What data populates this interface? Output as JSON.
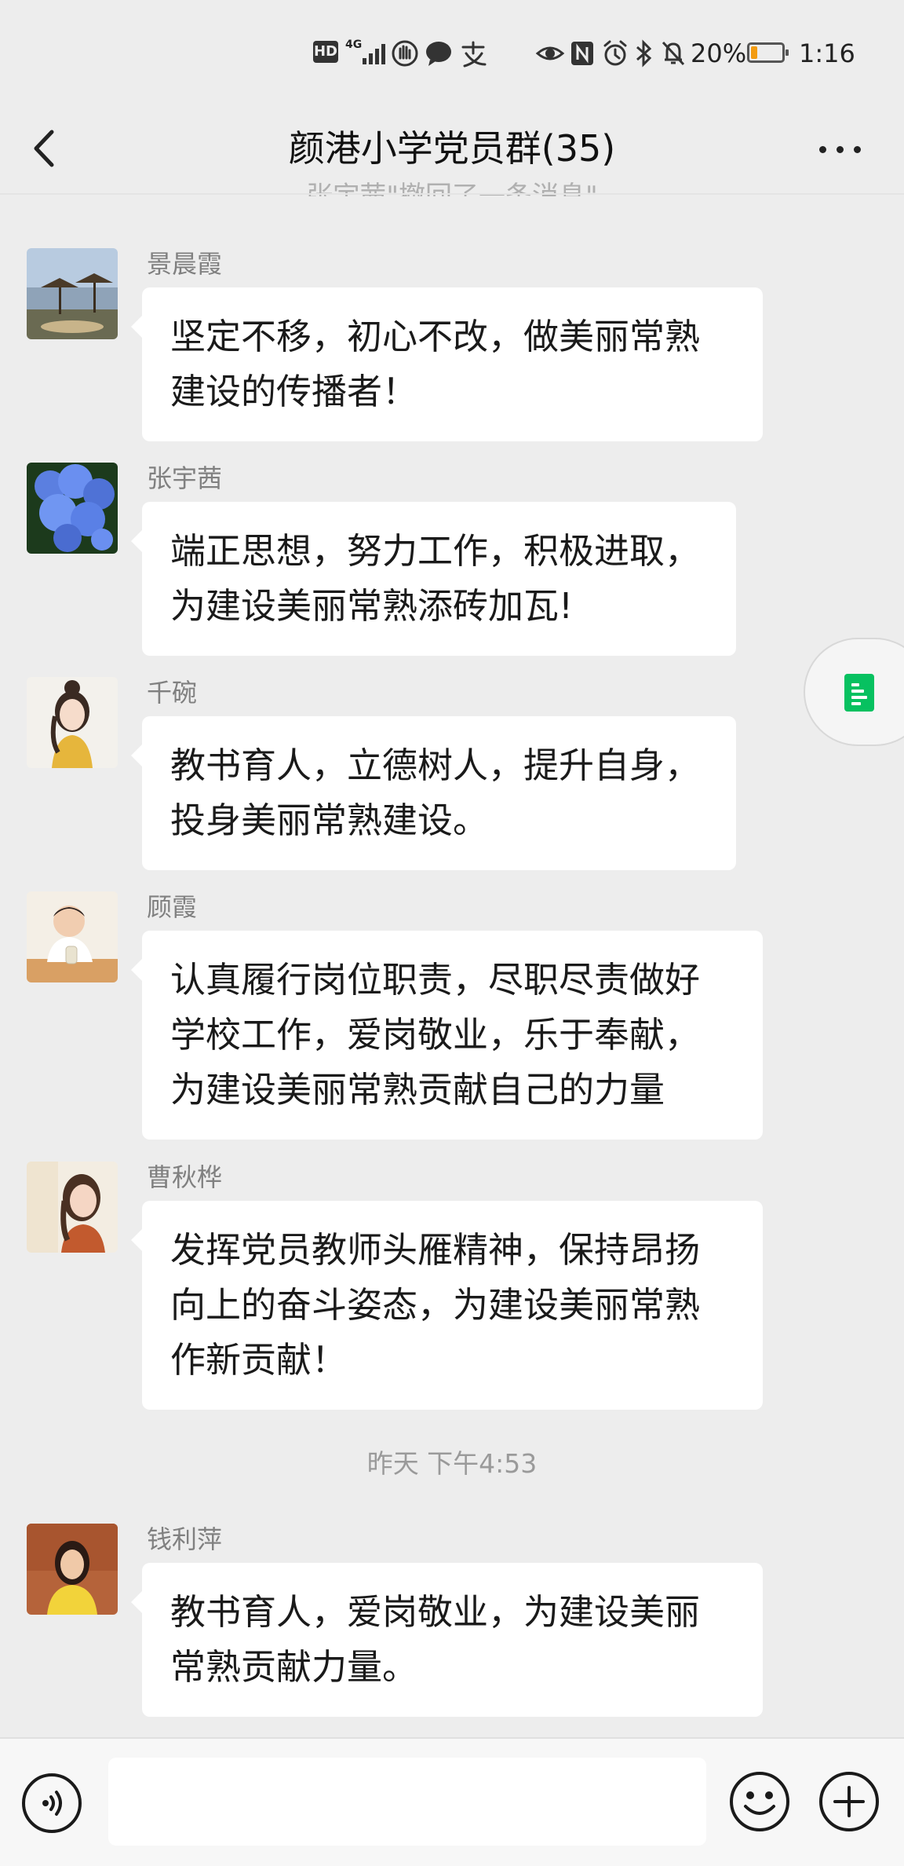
{
  "status_bar": {
    "hd": "HD",
    "network": "4G",
    "battery": "20%",
    "battery_level": 0.2,
    "time": "1:16",
    "icons": [
      "hd-icon",
      "signal-icon",
      "hand-icon",
      "chat-bubble-icon",
      "app-icon",
      "eye-icon",
      "nfc-icon",
      "alarm-icon",
      "bluetooth-icon",
      "mute-icon",
      "battery-icon"
    ]
  },
  "header": {
    "title": "颜港小学党员群(35)",
    "back_icon": "chevron-left-icon",
    "more_icon": "more-dots-icon"
  },
  "recall_notice": "张宇茜\"撤回了一条消息\"",
  "messages": [
    {
      "sender": "景晨霞",
      "lines": [
        "坚定不移，初心不改，做美丽常熟",
        "建设的传播者！"
      ]
    },
    {
      "sender": "张宇茜",
      "lines": [
        "端正思想，努力工作，积极进取，",
        "为建设美丽常熟添砖加瓦!"
      ]
    },
    {
      "sender": "千碗",
      "lines": [
        "教书育人，立德树人，提升自身，",
        "投身美丽常熟建设。"
      ]
    },
    {
      "sender": "顾霞",
      "lines": [
        "认真履行岗位职责，尽职尽责做好",
        "学校工作，爱岗敬业，乐于奉献，",
        "为建设美丽常熟贡献自己的力量"
      ]
    },
    {
      "sender": "曹秋桦",
      "lines": [
        "发挥党员教师头雁精神，保持昂扬",
        "向上的奋斗姿态，为建设美丽常熟",
        "作新贡献！"
      ]
    },
    {
      "sender": "钱利萍",
      "lines": [
        "教书育人，爱岗敬业，为建设美丽",
        "常熟贡献力量。"
      ]
    }
  ],
  "timestamp": "昨天 下午4:53",
  "float_button": {
    "icon": "document-icon",
    "color": "#07c160"
  },
  "input_bar": {
    "voice_icon": "voice-icon",
    "placeholder": "",
    "value": "",
    "emoji_icon": "emoji-icon",
    "plus_icon": "plus-icon"
  },
  "colors": {
    "background": "#ededed",
    "bubble": "#ffffff",
    "accent": "#07c160"
  }
}
